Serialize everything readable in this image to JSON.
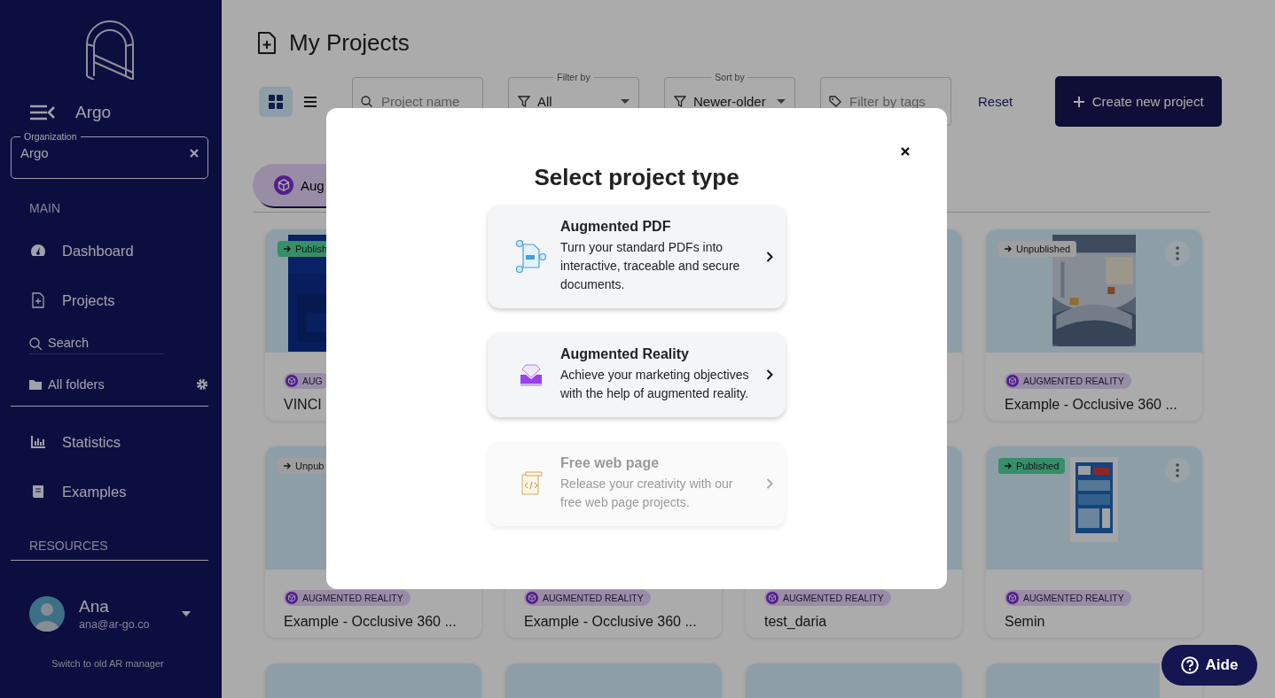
{
  "sidebar": {
    "brand": "Argo",
    "organization": {
      "label": "Organization",
      "value": "Argo"
    },
    "main_heading": "MAIN",
    "main_items": [
      {
        "label": "Dashboard"
      },
      {
        "label": "Projects"
      }
    ],
    "search": {
      "placeholder": "Search"
    },
    "folders": {
      "label": "All folders"
    },
    "more_items": [
      {
        "label": "Statistics"
      },
      {
        "label": "Examples"
      }
    ],
    "resources_heading": "RESOURCES",
    "user": {
      "name": "Ana",
      "email": "ana@ar-go.co"
    },
    "switch_link": "Switch to old AR manager"
  },
  "main": {
    "title": "My Projects",
    "view_toggle": [
      {
        "selected": true
      },
      {
        "selected": false
      }
    ],
    "project_search": {
      "placeholder": "Project name"
    },
    "filter": {
      "label": "Filter by",
      "value": "All"
    },
    "sort": {
      "label": "Sort by",
      "value": "Newer-older"
    },
    "tag_filter": {
      "placeholder": "Filter by tags"
    },
    "reset": "Reset",
    "create_button": "Create new project",
    "tabs": [
      {
        "label": "Aug",
        "selected": true
      }
    ],
    "cards": [
      {
        "status": {
          "text": "Publish",
          "kind": "published"
        },
        "tag": "AUG",
        "title": "VINCI"
      },
      {
        "status": {
          "text": "Unpublished",
          "kind": "unpublished"
        },
        "tag": "AUGMENTED REALITY",
        "title": "Example - Occlusive 360 ..."
      },
      {
        "status": {
          "text": "Unpub",
          "kind": "unpublished"
        },
        "tag": "AUGMENTED REALITY",
        "title": "Example - Occlusive 360 ..."
      },
      {
        "tag": "AUGMENTED REALITY",
        "title": "Example - Occlusive 360 ..."
      },
      {
        "tag": "AUGMENTED REALITY",
        "title": "test_daria"
      },
      {
        "status": {
          "text": "Published",
          "kind": "published"
        },
        "tag": "AUGMENTED REALITY",
        "title": "Semin"
      }
    ]
  },
  "modal": {
    "title": "Select project type",
    "options": [
      {
        "title": "Augmented PDF",
        "description": "Turn your standard PDFs into interactive, traceable and secure documents.",
        "disabled": false
      },
      {
        "title": "Augmented Reality",
        "description": "Achieve your marketing objectives with the help of augmented reality.",
        "disabled": false
      },
      {
        "title": "Free web page",
        "description": "Release your creativity with our free web page projects.",
        "disabled": true
      }
    ]
  },
  "help_button": {
    "label": "Aide"
  }
}
